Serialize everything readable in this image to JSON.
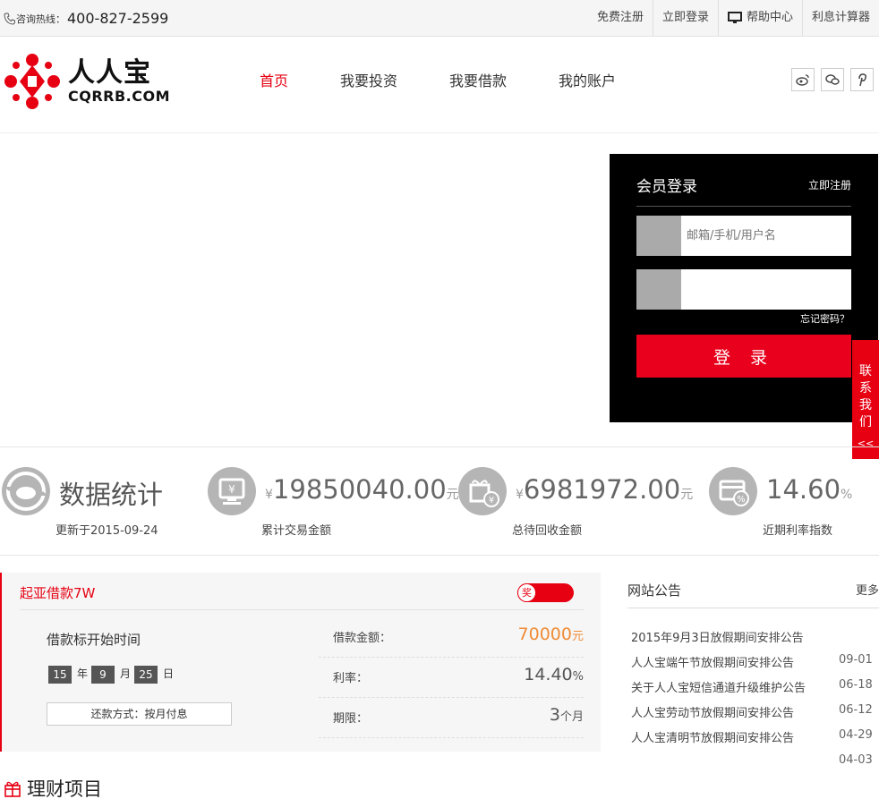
{
  "topbar": {
    "hotline_label": "咨询热线：",
    "hotline_number": "400-827-2599",
    "links": [
      "免费注册",
      "立即登录",
      "帮助中心",
      "利息计算器"
    ]
  },
  "logo": {
    "cn": "人人宝",
    "en": "CQRRB.COM"
  },
  "nav": [
    "首页",
    "我要投资",
    "我要借款",
    "我的账户"
  ],
  "login": {
    "title": "会员登录",
    "register": "立即注册",
    "username_placeholder": "邮箱/手机/用户名",
    "forgot": "忘记密码？",
    "submit": "登 录"
  },
  "contact": "联系我们",
  "contact_arrow": "<<",
  "stats": {
    "title": "数据统计",
    "updated": "更新于2015-09-24",
    "items": [
      {
        "currency": "¥",
        "value": "19850040.00",
        "unit": "元",
        "label": "累计交易金额"
      },
      {
        "currency": "¥",
        "value": "6981972.00",
        "unit": "元",
        "label": "总待回收金额"
      },
      {
        "currency": "",
        "value": "14.60",
        "unit": "%",
        "label": "近期利率指数"
      }
    ]
  },
  "loan": {
    "title": "起亚借款7W",
    "tag": "奖",
    "start_label": "借款标开始时间",
    "date": {
      "year": "15",
      "year_unit": "年",
      "month": "9",
      "month_unit": "月",
      "day": "25",
      "day_unit": "日"
    },
    "repay": "还款方式：按月付息",
    "rows": [
      {
        "label": "借款金额：",
        "value": "70000",
        "unit": "元"
      },
      {
        "label": "利率：",
        "value": "14.40",
        "unit": "%"
      },
      {
        "label": "期限：",
        "value": "3",
        "unit": "个月"
      }
    ]
  },
  "notice": {
    "title": "网站公告",
    "more": "更多",
    "items": [
      {
        "title": "2015年9月3日放假期间安排公告",
        "date": "09-01"
      },
      {
        "title": "人人宝端午节放假期间安排公告",
        "date": "06-18"
      },
      {
        "title": "关于人人宝短信通道升级维护公告",
        "date": "06-12"
      },
      {
        "title": "人人宝劳动节放假期间安排公告",
        "date": "04-29"
      },
      {
        "title": "人人宝清明节放假期间安排公告",
        "date": "04-03"
      }
    ]
  },
  "section_title": "理财项目",
  "colors": {
    "brand": "#e60012",
    "orange": "#f08c35",
    "dark": "#000000"
  }
}
